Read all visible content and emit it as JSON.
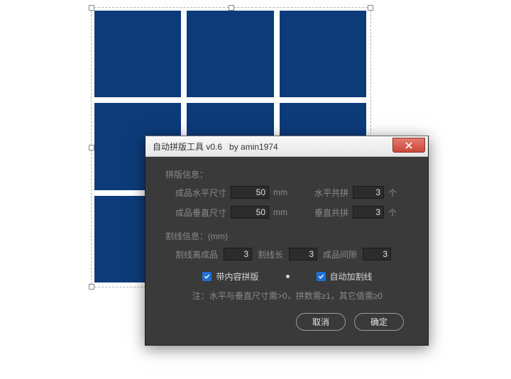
{
  "dialog": {
    "title": "自动拼版工具 v0.6   by amin1974",
    "section_layout": "拼版信息：",
    "h_size_label": "成品水平尺寸",
    "h_size_value": "50",
    "h_size_unit": "mm",
    "h_count_label": "水平共拼",
    "h_count_value": "3",
    "h_count_unit": "个",
    "v_size_label": "成品垂直尺寸",
    "v_size_value": "50",
    "v_size_unit": "mm",
    "v_count_label": "垂直共拼",
    "v_count_value": "3",
    "v_count_unit": "个",
    "section_cut": "割线信息：(mm)",
    "cut_offset_label": "割线离成品",
    "cut_offset_value": "3",
    "cut_len_label": "割线长",
    "cut_len_value": "3",
    "gap_label": "成品间隙",
    "gap_value": "3",
    "chk_content": "带内容拼版",
    "chk_cut": "自动加割线",
    "note": "注：水平与垂直尺寸需>0，拼数需≥1，其它值需≥0",
    "btn_cancel": "取消",
    "btn_ok": "确定"
  }
}
